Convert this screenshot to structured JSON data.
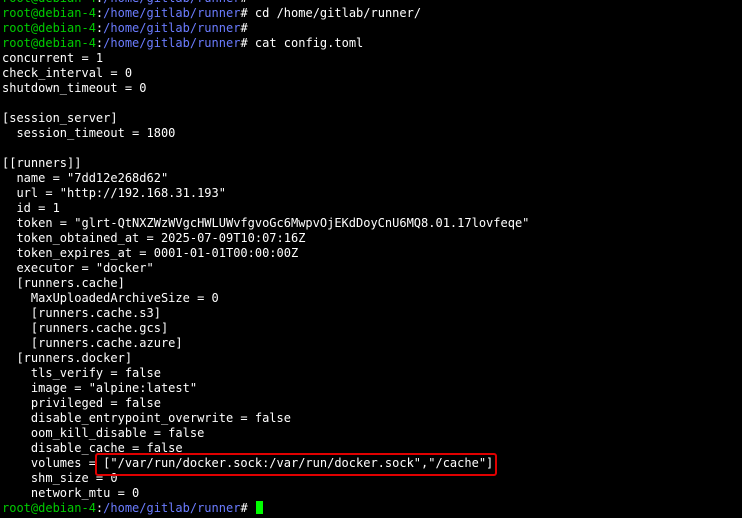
{
  "prompt": {
    "user_host": "root@debian-4",
    "sep": ":",
    "path": "/home/gitlab/runner",
    "symbol": "#"
  },
  "commands": {
    "cd": "cd /home/gitlab/runner/",
    "cat": "cat config.toml"
  },
  "config_lines": [
    "concurrent = 1",
    "check_interval = 0",
    "shutdown_timeout = 0",
    "",
    "[session_server]",
    "  session_timeout = 1800",
    "",
    "[[runners]]",
    "  name = \"7dd12e268d62\"",
    "  url = \"http://192.168.31.193\"",
    "  id = 1",
    "  token = \"glrt-QtNXZWzWVgcHWLUWvfgvoGc6MwpvOjEKdDoyCnU6MQ8.01.17lovfeqe\"",
    "  token_obtained_at = 2025-07-09T10:07:16Z",
    "  token_expires_at = 0001-01-01T00:00:00Z",
    "  executor = \"docker\"",
    "  [runners.cache]",
    "    MaxUploadedArchiveSize = 0",
    "    [runners.cache.s3]",
    "    [runners.cache.gcs]",
    "    [runners.cache.azure]",
    "  [runners.docker]",
    "    tls_verify = false",
    "    image = \"alpine:latest\"",
    "    privileged = false",
    "    disable_entrypoint_overwrite = false",
    "    oom_kill_disable = false",
    "    disable_cache = false",
    "    volumes = [\"/var/run/docker.sock:/var/run/docker.sock\",\"/cache\"]",
    "    shm_size = 0",
    "    network_mtu = 0"
  ],
  "colors": {
    "background": "#000000",
    "text": "#ffffff",
    "prompt_user": "#00cc00",
    "prompt_path": "#6b7cff",
    "cursor": "#00ff00",
    "highlight_border": "#e00000"
  }
}
